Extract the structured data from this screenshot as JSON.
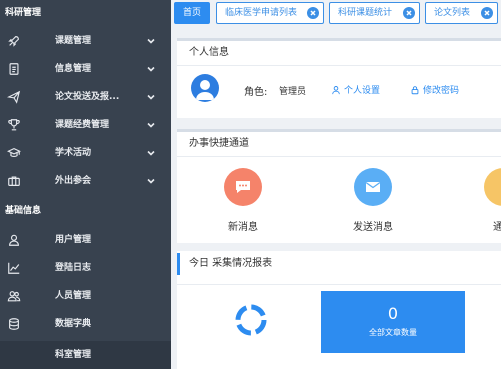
{
  "sidebar": {
    "sections": [
      {
        "title": "科研管理",
        "items": [
          {
            "label": "课题管理",
            "icon": "rocket-icon"
          },
          {
            "label": "信息管理",
            "icon": "document-icon"
          },
          {
            "label": "论文投送及报...",
            "icon": "paper-plane-icon"
          },
          {
            "label": "课题经费管理",
            "icon": "trophy-icon"
          },
          {
            "label": "学术活动",
            "icon": "graduation-cap-icon"
          },
          {
            "label": "外出参会",
            "icon": "briefcase-icon"
          }
        ]
      },
      {
        "title": "基础信息",
        "items": [
          {
            "label": "用户管理",
            "icon": "user-icon"
          },
          {
            "label": "登陆日志",
            "icon": "line-chart-icon"
          },
          {
            "label": "人员管理",
            "icon": "users-icon"
          },
          {
            "label": "数据字典",
            "icon": "database-icon"
          },
          {
            "label": "科室管理",
            "icon": ""
          }
        ]
      }
    ]
  },
  "tabs": [
    {
      "label": "首页",
      "active": true
    },
    {
      "label": "临床医学申请列表",
      "closable": true
    },
    {
      "label": "科研课题统计",
      "closable": true
    },
    {
      "label": "论文列表",
      "closable": true
    }
  ],
  "personal": {
    "title": "个人信息",
    "role_label": "角色:",
    "role_value": "管理员",
    "settings_link": "个人设置",
    "password_link": "修改密码"
  },
  "quick": {
    "title": "办事快捷通道",
    "items": [
      {
        "label": "新消息",
        "color": "#f5836a"
      },
      {
        "label": "发送消息",
        "color": "#5aaef5"
      },
      {
        "label": "通知",
        "color": "#f6c566"
      }
    ]
  },
  "report": {
    "title": "今日 采集情况报表",
    "total_value": "0",
    "total_caption": "全部文章数量"
  },
  "colors": {
    "accent": "#2d8cf0",
    "sidebar": "#38424f"
  }
}
